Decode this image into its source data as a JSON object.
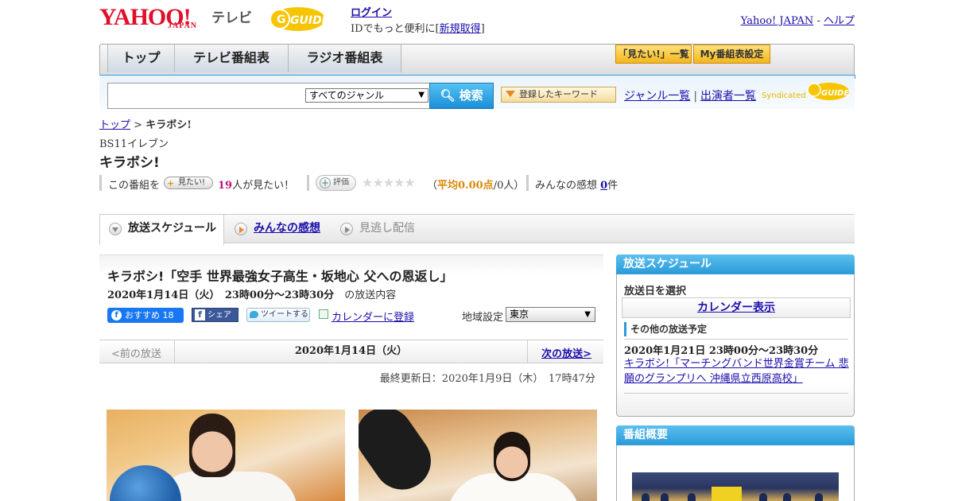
{
  "header": {
    "logo_yahoo": "YAHOO!",
    "logo_japan": "JAPAN",
    "logo_tv": "テレビ",
    "logo_gguide": "GUIDE",
    "login_link": "ログイン",
    "login_prompt": "IDでもっと便利に[",
    "signup_link": "新規取得",
    "login_close": "]",
    "right_link_1": "Yahoo! JAPAN",
    "right_sep": " - ",
    "right_link_2": "ヘルプ"
  },
  "nav": {
    "tabs": [
      {
        "label": "トップ"
      },
      {
        "label": "テレビ番組表"
      },
      {
        "label": "ラジオ番組表"
      }
    ],
    "btn_mitai_list": "「見たい!」一覧",
    "btn_my_schedule": "My番組表設定"
  },
  "search": {
    "input_value": "",
    "genre_selected": "すべてのジャンル",
    "search_button": "検索",
    "keyword_button": "登録したキーワード",
    "genre_list_link": "ジャンル一覧",
    "sep": "|",
    "performer_list_link": "出演者一覧",
    "syndicated": "Syndicated",
    "syndicated_logo": "GUIDE"
  },
  "breadcrumb": {
    "top": "トップ",
    "separator": " > ",
    "current": "キラボシ!"
  },
  "program": {
    "channel": "BS11イレブン",
    "title": "キラボシ!",
    "mitai_prefix": "この番組を",
    "mitai_button": "見たい!",
    "mitai_count": "19",
    "mitai_suffix": "人が見たい！",
    "rating_button": "評価",
    "stars": "★★★★★",
    "rating_open": "（",
    "rating_avg": "平均0.00点",
    "rating_count": "/0人）",
    "impressions_label": "みんなの感想",
    "impressions_count": "0",
    "impressions_suffix": "件"
  },
  "content_tabs": [
    {
      "label": "放送スケジュール"
    },
    {
      "label": "みんなの感想"
    },
    {
      "label": "見逃し配信"
    }
  ],
  "episode": {
    "title": "キラボシ!「空手 世界最強女子高生・坂地心 父への恩返し」",
    "date_time": "2020年1月14日（火）　23時00分～23時30分",
    "date_suffix": "の放送内容"
  },
  "social": {
    "fb_recommend": "おすすめ 18",
    "fb_share": "シェア",
    "tweet": "ツイートする",
    "calendar": "カレンダーに登録",
    "region_label": "地域設定",
    "region_value": "東京"
  },
  "pager": {
    "prev": "<前の放送",
    "current": "2020年1月14日（火）",
    "next": "次の放送>"
  },
  "updated": "最終更新日：2020年1月9日（木）　17時47分",
  "sidebar": {
    "schedule_header": "放送スケジュール",
    "select_date": "放送日を選択",
    "calendar_button": "カレンダー表示",
    "other_header": "その他の放送予定",
    "other_date": "2020年1月21日  23時00分～23時30分",
    "other_link": "キラボシ!「マーチングバンド世界金賞チーム 悲願のグランプリへ 沖縄県立西原高校」",
    "summary_header": "番組概要"
  },
  "colors": {
    "accent_blue": "#2f9be0",
    "yahoo_red": "#e0102a",
    "rating_orange": "#d9880c",
    "count_pink": "#c0177a"
  }
}
